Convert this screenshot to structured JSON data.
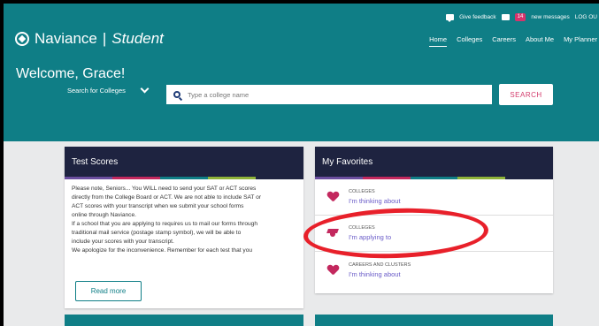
{
  "topbar": {
    "feedback": "Give feedback",
    "message_count": "14",
    "messages": "new messages",
    "logout": "LOG OU"
  },
  "brand": {
    "name": "Naviance",
    "separator": "|",
    "sub": "Student"
  },
  "nav": {
    "items": [
      "Home",
      "Colleges",
      "Careers",
      "About Me",
      "My Planner"
    ],
    "active": "Home"
  },
  "welcome": "Welcome, Grace!",
  "search": {
    "type_label": "Search for Colleges",
    "placeholder": "Type a college name",
    "button": "SEARCH"
  },
  "test_scores": {
    "title": "Test Scores",
    "body": [
      "Please note, Seniors... You WILL need to send your SAT or ACT scores",
      "directly from the College Board or ACT. We are not able to include SAT or",
      "ACT scores with your transcript when we submit your school forms",
      "online through Naviance.",
      "If a school that you are applying to requires us to mail our forms through",
      "traditional mail service (postage stamp symbol), we will be able to",
      "include your scores with your transcript.",
      "We apologize for the inconvenience. Remember for each test that you"
    ],
    "read_more": "Read more"
  },
  "favorites": {
    "title": "My Favorites",
    "items": [
      {
        "category": "COLLEGES",
        "label": "I'm thinking about",
        "icon": "heart-icon"
      },
      {
        "category": "COLLEGES",
        "label": "I'm applying to",
        "icon": "graduation-cap-icon"
      },
      {
        "category": "CAREERS AND CLUSTERS",
        "label": "I'm thinking about",
        "icon": "heart-icon"
      }
    ]
  },
  "colors": {
    "teal": "#0f7e86",
    "navy": "#1e2340",
    "accent": "#d33b6c",
    "link": "#6a5cc8",
    "highlight": "#e8202a"
  },
  "stripe_colors": [
    "#6b4fa0",
    "#c3285e",
    "#0f7e86",
    "#8fb339",
    "#1e2340"
  ]
}
